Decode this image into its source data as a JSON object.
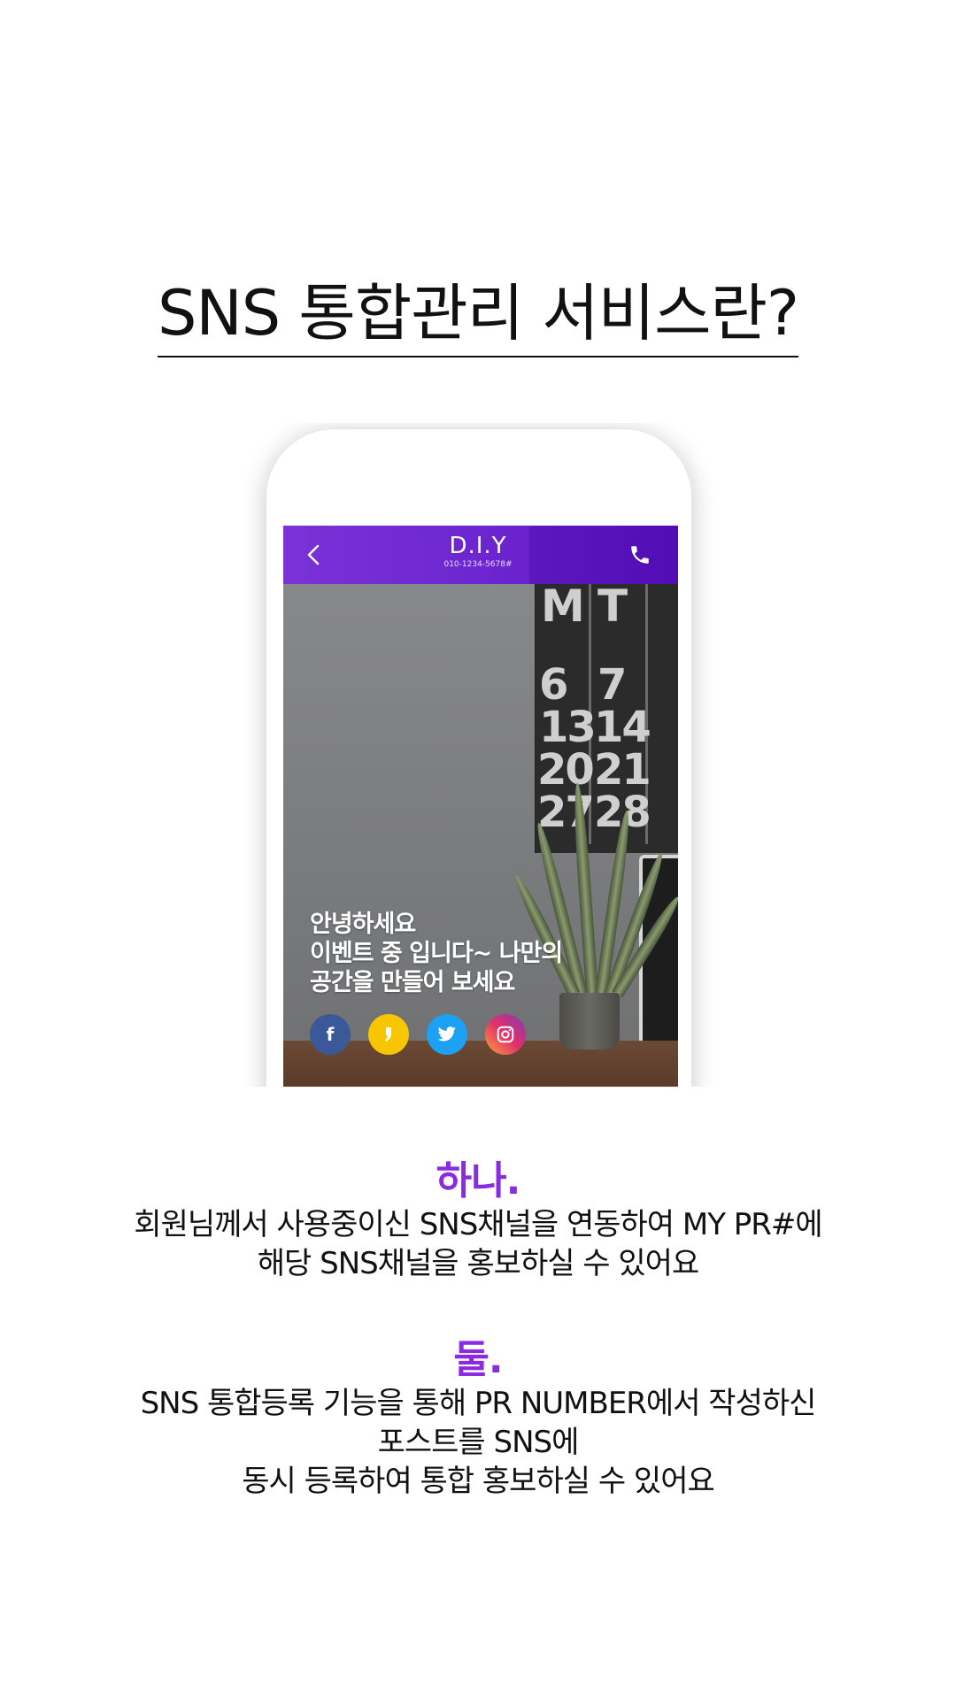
{
  "page": {
    "title": "SNS 통합관리 서비스란?"
  },
  "phone": {
    "app_bar": {
      "back_icon": "chevron-left-icon",
      "brand_name": "D.I.Y",
      "brand_phone": "010-1234-5678#",
      "call_icon": "phone-icon",
      "color": "#6c24cf"
    },
    "calendar": {
      "headers": [
        "M",
        "T"
      ],
      "rows": [
        [
          "6",
          "7"
        ],
        [
          "13",
          "14"
        ],
        [
          "20",
          "21"
        ],
        [
          "27",
          "28"
        ]
      ]
    },
    "overlay": {
      "lines": [
        "안녕하세요",
        "이벤트 중 입니다~ 나만의",
        "공간을 만들어 보세요"
      ]
    },
    "social": [
      {
        "name": "facebook",
        "icon": "facebook-icon",
        "glyph": "f",
        "color": "#3b5998"
      },
      {
        "name": "kakaostory",
        "icon": "kakaostory-icon",
        "glyph": "❜",
        "color": "#f7c600"
      },
      {
        "name": "twitter",
        "icon": "twitter-icon",
        "glyph": "🐦",
        "color": "#1da1f2"
      },
      {
        "name": "instagram",
        "icon": "instagram-icon",
        "glyph": "◎",
        "color": "#d6307a"
      }
    ]
  },
  "features": [
    {
      "number": "하나.",
      "lines": [
        "회원님께서 사용중이신 SNS채널을 연동하여 MY PR#에",
        "해당 SNS채널을 홍보하실 수 있어요"
      ]
    },
    {
      "number": "둘.",
      "lines": [
        "SNS 통합등록 기능을 통해 PR NUMBER에서 작성하신",
        "포스트를 SNS에",
        "동시 등록하여 통합 홍보하실 수 있어요"
      ]
    }
  ],
  "accent_color": "#8a2be2"
}
